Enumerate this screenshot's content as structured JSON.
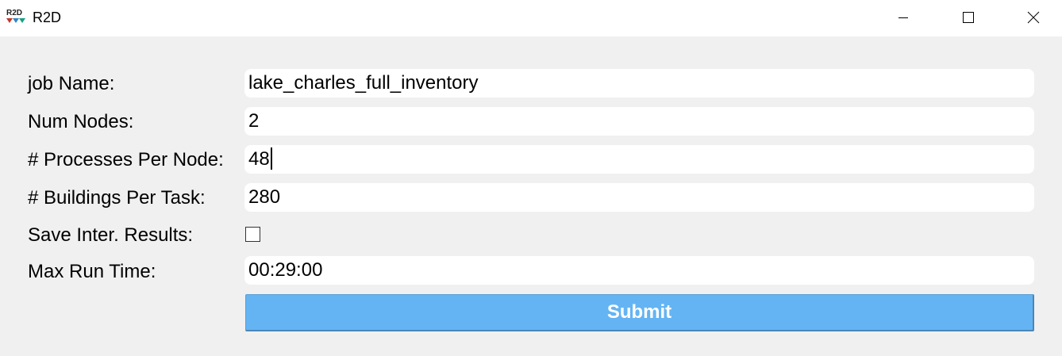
{
  "window": {
    "title": "R2D",
    "icon": "r2d-logo-icon",
    "icon_text": "R2D",
    "controls": [
      "minimize-icon",
      "maximize-icon",
      "close-icon"
    ]
  },
  "form": {
    "job_name_label": "job Name:",
    "job_name_value": "lake_charles_full_inventory",
    "num_nodes_label": "Num Nodes:",
    "num_nodes_value": "2",
    "processes_label": "# Processes Per Node:",
    "processes_value": "48",
    "buildings_label": "# Buildings Per Task:",
    "buildings_value": "280",
    "save_results_label": "Save Inter. Results:",
    "save_results_checked": false,
    "max_run_time_label": "Max Run Time:",
    "max_run_time_value": "00:29:00",
    "submit_label": "Submit"
  },
  "colors": {
    "background": "#f0f0f0",
    "field_background": "#ffffff",
    "submit_background": "#64b4f3",
    "submit_text": "#ffffff"
  }
}
